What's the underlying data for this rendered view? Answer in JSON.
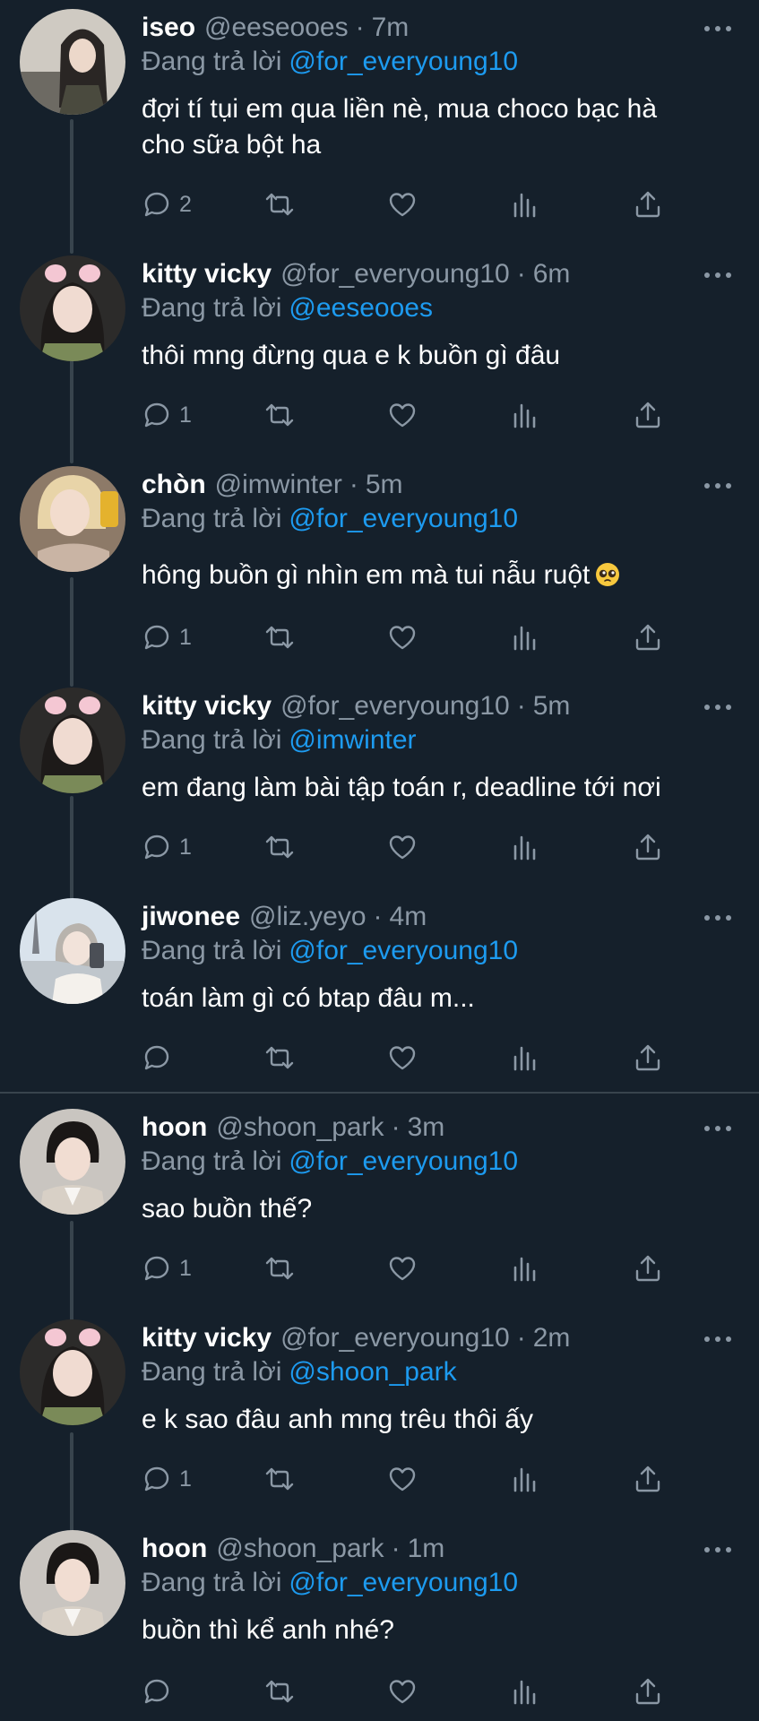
{
  "replying_label": "Đang trả lời",
  "tweets": [
    {
      "name": "iseo",
      "handle": "@eeseooes",
      "time": "7m",
      "reply_to": "@for_everyoung10",
      "lines": [
        "đợi tí tụi em qua liền nè, mua choco bạc hà",
        "cho sữa bột ha"
      ],
      "replies": "2"
    },
    {
      "name": "kitty vicky",
      "handle": "@for_everyoung10",
      "time": "6m",
      "reply_to": "@eeseooes",
      "lines": [
        "thôi mng đừng qua e k buồn gì đâu"
      ],
      "replies": "1"
    },
    {
      "name": "chòn",
      "handle": "@imwinter",
      "time": "5m",
      "reply_to": "@for_everyoung10",
      "lines": [
        "hông buồn gì nhìn em mà tui nẫu ruột"
      ],
      "replies": "1",
      "emoji": "pleading-face-emoji"
    },
    {
      "name": "kitty vicky",
      "handle": "@for_everyoung10",
      "time": "5m",
      "reply_to": "@imwinter",
      "lines": [
        "em đang làm bài tập toán r, deadline tới nơi"
      ],
      "replies": "1"
    },
    {
      "name": "jiwonee",
      "handle": "@liz.yeyo",
      "time": "4m",
      "reply_to": "@for_everyoung10",
      "lines": [
        "toán làm gì có btap đâu m..."
      ],
      "replies": ""
    },
    {
      "name": "hoon",
      "handle": "@shoon_park",
      "time": "3m",
      "reply_to": "@for_everyoung10",
      "lines": [
        "sao buồn thế?"
      ],
      "replies": "1"
    },
    {
      "name": "kitty vicky",
      "handle": "@for_everyoung10",
      "time": "2m",
      "reply_to": "@shoon_park",
      "lines": [
        "e k sao đâu anh mng trêu thôi ấy"
      ],
      "replies": "1"
    },
    {
      "name": "hoon",
      "handle": "@shoon_park",
      "time": "1m",
      "reply_to": "@for_everyoung10",
      "lines": [
        "buồn thì kể anh nhé?"
      ],
      "replies": ""
    }
  ],
  "colors": {
    "background": "#15202b",
    "secondary_text": "#8b98a5",
    "mention": "#1d9bf0",
    "divider": "#38444d"
  }
}
